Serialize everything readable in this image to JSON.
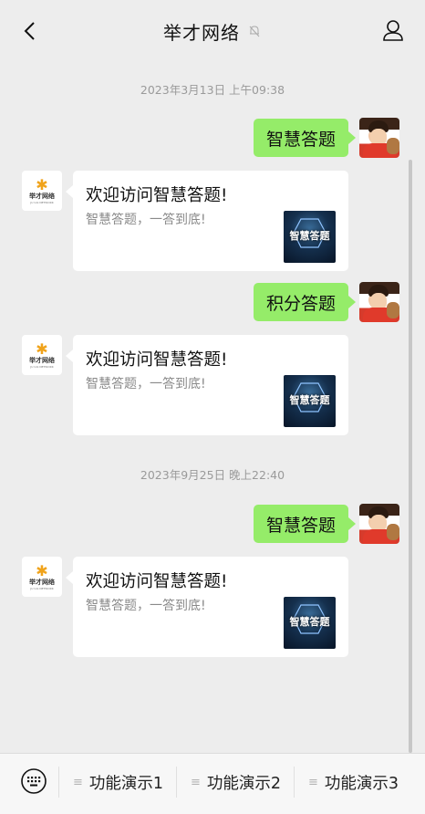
{
  "header": {
    "title": "举才网络"
  },
  "messages": {
    "timestamps": [
      "2023年3月13日 上午09:38",
      "2023年9月25日 晚上22:40"
    ],
    "outgoing": [
      "智慧答题",
      "积分答题",
      "智慧答题"
    ],
    "cards": [
      {
        "title": "欢迎访问智慧答题!",
        "desc": "智慧答题，一答到底!",
        "thumb_text": "智慧答题"
      },
      {
        "title": "欢迎访问智慧答题!",
        "desc": "智慧答题，一答到底!",
        "thumb_text": "智慧答题"
      },
      {
        "title": "欢迎访问智慧答题!",
        "desc": "智慧答题，一答到底!",
        "thumb_text": "智慧答题"
      }
    ],
    "bot_avatar": {
      "brand": "举才网络",
      "sub": "JU CAI NETWORK"
    }
  },
  "bottom_menu": {
    "items": [
      "功能演示1",
      "功能演示2",
      "功能演示3"
    ],
    "item_icon": "≡"
  },
  "colors": {
    "background": "#ededed",
    "outgoing_bubble": "#95ec69",
    "card": "#ffffff"
  },
  "icons": [
    "back-icon",
    "mute-bell-icon",
    "profile-icon",
    "keyboard-icon",
    "menu-lines-icon"
  ]
}
